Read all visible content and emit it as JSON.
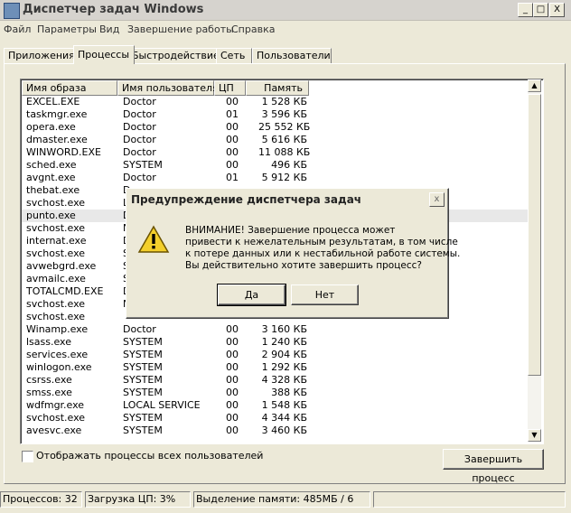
{
  "window": {
    "title": "Диспетчер задач Windows",
    "min": "_",
    "max": "□",
    "close": "X"
  },
  "menu": [
    "Файл",
    "Параметры",
    "Вид",
    "Завершение работы",
    "Справка"
  ],
  "tabs": [
    "Приложения",
    "Процессы",
    "Быстродействие",
    "Сеть",
    "Пользователи"
  ],
  "active_tab": "Процессы",
  "columns": [
    "Имя образа",
    "Имя пользователя",
    "ЦП",
    "Память"
  ],
  "processes": [
    {
      "name": "EXCEL.EXE",
      "user": "Doctor",
      "cpu": "00",
      "mem": "1 528 КБ"
    },
    {
      "name": "taskmgr.exe",
      "user": "Doctor",
      "cpu": "01",
      "mem": "3 596 КБ"
    },
    {
      "name": "opera.exe",
      "user": "Doctor",
      "cpu": "00",
      "mem": "25 552 КБ"
    },
    {
      "name": "dmaster.exe",
      "user": "Doctor",
      "cpu": "00",
      "mem": "5 616 КБ"
    },
    {
      "name": "WINWORD.EXE",
      "user": "Doctor",
      "cpu": "00",
      "mem": "11 088 КБ"
    },
    {
      "name": "sched.exe",
      "user": "SYSTEM",
      "cpu": "00",
      "mem": "496 КБ"
    },
    {
      "name": "avgnt.exe",
      "user": "Doctor",
      "cpu": "01",
      "mem": "5 912 КБ"
    },
    {
      "name": "thebat.exe",
      "user": "D",
      "cpu": "",
      "mem": ""
    },
    {
      "name": "svchost.exe",
      "user": "L",
      "cpu": "",
      "mem": ""
    },
    {
      "name": "punto.exe",
      "user": "D",
      "cpu": "",
      "mem": ""
    },
    {
      "name": "svchost.exe",
      "user": "N",
      "cpu": "",
      "mem": ""
    },
    {
      "name": "internat.exe",
      "user": "D",
      "cpu": "",
      "mem": ""
    },
    {
      "name": "svchost.exe",
      "user": "S",
      "cpu": "",
      "mem": ""
    },
    {
      "name": "avwebgrd.exe",
      "user": "S",
      "cpu": "",
      "mem": ""
    },
    {
      "name": "avmailc.exe",
      "user": "S",
      "cpu": "",
      "mem": ""
    },
    {
      "name": "TOTALCMD.EXE",
      "user": "D",
      "cpu": "",
      "mem": ""
    },
    {
      "name": "svchost.exe",
      "user": "N",
      "cpu": "",
      "mem": ""
    },
    {
      "name": "svchost.exe",
      "user": "",
      "cpu": "",
      "mem": ""
    },
    {
      "name": "Winamp.exe",
      "user": "Doctor",
      "cpu": "00",
      "mem": "3 160 КБ"
    },
    {
      "name": "lsass.exe",
      "user": "SYSTEM",
      "cpu": "00",
      "mem": "1 240 КБ"
    },
    {
      "name": "services.exe",
      "user": "SYSTEM",
      "cpu": "00",
      "mem": "2 904 КБ"
    },
    {
      "name": "winlogon.exe",
      "user": "SYSTEM",
      "cpu": "00",
      "mem": "1 292 КБ"
    },
    {
      "name": "csrss.exe",
      "user": "SYSTEM",
      "cpu": "00",
      "mem": "4 328 КБ"
    },
    {
      "name": "smss.exe",
      "user": "SYSTEM",
      "cpu": "00",
      "mem": "388 КБ"
    },
    {
      "name": "wdfmgr.exe",
      "user": "LOCAL SERVICE",
      "cpu": "00",
      "mem": "1 548 КБ"
    },
    {
      "name": "svchost.exe",
      "user": "SYSTEM",
      "cpu": "00",
      "mem": "4 344 КБ"
    },
    {
      "name": "avesvc.exe",
      "user": "SYSTEM",
      "cpu": "00",
      "mem": "3 460 КБ"
    }
  ],
  "selected_process": "punto.exe",
  "show_all_users_label": "Отображать процессы всех пользователей",
  "end_process_label": "Завершить процесс",
  "status": {
    "processes": "Процессов: 32",
    "cpu": "Загрузка ЦП: 3%",
    "memory": "Выделение памяти: 485МБ / 6"
  },
  "dialog": {
    "title": "Предупреждение диспетчера задач",
    "close": "x",
    "icon": "warning-icon",
    "message_lines": [
      "ВНИМАНИЕ! Завершение процесса может",
      "привести к нежелательным результатам, в том числе",
      "к потере данных или к нестабильной работе системы.",
      "Вы действительно хотите завершить процесс?"
    ],
    "yes": "Да",
    "no": "Нет"
  }
}
